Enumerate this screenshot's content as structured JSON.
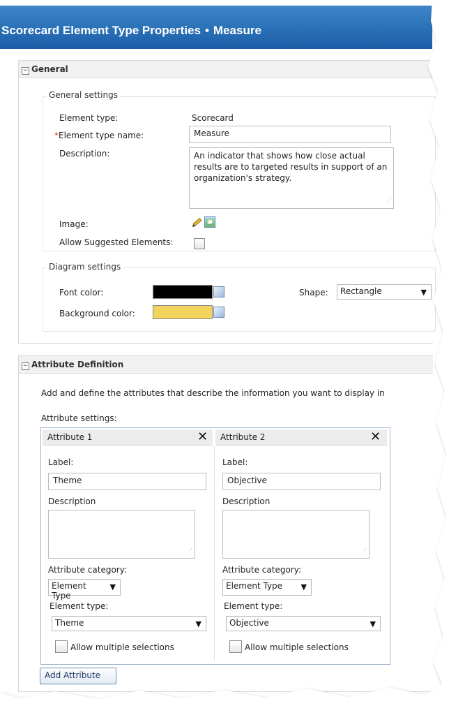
{
  "title": {
    "main": "Scorecard Element Type Properties",
    "separator": "•",
    "sub": "Measure"
  },
  "general": {
    "section_title": "General",
    "settings_group": "General settings",
    "element_type_label": "Element type:",
    "element_type_value": "Scorecard",
    "required_mark": "*",
    "name_label": "Element type name:",
    "name_value": "Measure",
    "description_label": "Description:",
    "description_value": "An indicator that shows how close actual results are to targeted results in support of an organization's strategy.",
    "image_label": "Image:",
    "allow_suggested_label": "Allow Suggested Elements:",
    "diagram_group": "Diagram settings",
    "font_color_label": "Font color:",
    "font_color": "#000000",
    "background_color_label": "Background color:",
    "background_color": "#f2d45c",
    "shape_label": "Shape:",
    "shape_value": "Rectangle"
  },
  "attributes": {
    "section_title": "Attribute Definition",
    "intro": "Add and define the attributes that describe the information you want to display in",
    "settings_label": "Attribute settings:",
    "items": [
      {
        "title": "Attribute 1",
        "label_caption": "Label:",
        "label_value": "Theme",
        "description_caption": "Description",
        "category_caption": "Attribute category:",
        "category_value": "Element Type",
        "type_caption": "Element type:",
        "type_value": "Theme",
        "allow_multiple": "Allow multiple selections"
      },
      {
        "title": "Attribute 2",
        "label_caption": "Label:",
        "label_value": "Objective",
        "description_caption": "Description",
        "category_caption": "Attribute category:",
        "category_value": "Element Type",
        "type_caption": "Element type:",
        "type_value": "Objective",
        "allow_multiple": "Allow multiple selections"
      }
    ],
    "add_button": "Add Attribute"
  },
  "colors": {
    "title_bar": "#1b5ea8",
    "accent": "#3d86c8",
    "required": "#dd3333"
  },
  "icons": {
    "section_toggle": "collapse-minus-icon",
    "remove": "close-x-icon",
    "color_picker": "color-picker-icon",
    "image_edit": "pencil-icon",
    "image_browse": "image-icon",
    "dropdown": "chevron-down-icon"
  }
}
